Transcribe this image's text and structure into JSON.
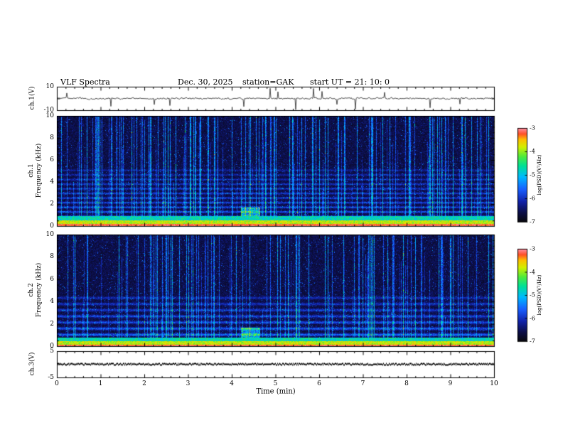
{
  "header": {
    "title": "VLF  Spectra",
    "date": "Dec. 30,  2025",
    "station": "station=GAK",
    "start_ut": "start UT  =   21: 10: 0"
  },
  "axes": {
    "x": {
      "label": "Time  (min)",
      "min": 0,
      "max": 10,
      "ticks": [
        0,
        1,
        2,
        3,
        4,
        5,
        6,
        7,
        8,
        9,
        10
      ]
    },
    "panels": [
      {
        "id": "ch1_wave",
        "ylabel": "ch.1(V)",
        "ymin": -10,
        "ymax": 10,
        "yticks": [
          10,
          -10
        ]
      },
      {
        "id": "ch1_spec",
        "ylabel_line1": "ch.1",
        "ylabel_line2": "Frequency (kHz)",
        "ymin": 0,
        "ymax": 10,
        "yticks": [
          0,
          2,
          4,
          6,
          8,
          10
        ]
      },
      {
        "id": "ch2_spec",
        "ylabel_line1": "ch.2",
        "ylabel_line2": "Frequency (kHz)",
        "ymin": 0,
        "ymax": 10,
        "yticks": [
          0,
          2,
          4,
          6,
          8,
          10
        ]
      },
      {
        "id": "ch3_wave",
        "ylabel": "ch.3(V)",
        "ymin": -5,
        "ymax": 5,
        "yticks": [
          5,
          -5
        ]
      }
    ]
  },
  "colorbars": [
    {
      "label": "log(PSD)(V²/Hz)",
      "min": -7,
      "max": -3,
      "ticks": [
        -3,
        -4,
        -5,
        -6,
        -7
      ]
    },
    {
      "label": "log(PSD)(V²/Hz)",
      "min": -7,
      "max": -3,
      "ticks": [
        -3,
        -4,
        -5,
        -6,
        -7
      ]
    }
  ],
  "colors": {
    "background": "#ffffff",
    "axis": "#000000",
    "colormap_low": "#000008",
    "colormap_mid": "#00b9ff",
    "colormap_high": "#ff91a5"
  },
  "chart_data": [
    {
      "type": "line",
      "panel": "ch1_waveform",
      "ylabel": "ch.1(V)",
      "xlim": [
        0,
        10
      ],
      "ylim": [
        -10,
        10
      ],
      "x_unit": "min",
      "description": "Continuous noisy VLF waveform centred near 0 V, typical excursions about ±2 V, with roughly 15 impulsive spikes reaching up to ±10 V across the 10-minute record"
    },
    {
      "type": "heatmap",
      "panel": "ch1_spectrogram",
      "ylabel": "ch.1 Frequency (kHz)",
      "xlabel": "Time (min)",
      "xlim": [
        0,
        10
      ],
      "ylim": [
        0,
        10
      ],
      "zlabel": "log(PSD)(V²/Hz)",
      "zlim": [
        -7,
        -3
      ],
      "features": [
        "intense red band below ~0.3 kHz (PSD near -3)",
        "yellow/green band from ~0.3 to 1 kHz (PSD near -4)",
        "horizontal banding between 1 and ~5 kHz (PSD near -5.5)",
        "dense vertical sferic streaks, many reaching 10 kHz, green/cyan (PSD near -4.5)",
        "dark background near -7 above 5 kHz",
        "small green enhancement near 1-1.7 kHz around t = 4.3-4.6 min"
      ]
    },
    {
      "type": "heatmap",
      "panel": "ch2_spectrogram",
      "ylabel": "ch.2 Frequency (kHz)",
      "xlabel": "Time (min)",
      "xlim": [
        0,
        10
      ],
      "ylim": [
        0,
        10
      ],
      "zlabel": "log(PSD)(V²/Hz)",
      "zlim": [
        -7,
        -3
      ],
      "features": [
        "thin red/yellow band below ~0.5 kHz",
        "strong horizontal banding between 1 and ~4.6 kHz",
        "fewer vertical sferic streaks than ch.1, mostly blue/cyan",
        "dark background near -7 above 5 kHz",
        "small green enhancement near 1-1.7 kHz around t = 4.3-4.6 min"
      ]
    },
    {
      "type": "line",
      "panel": "ch3_waveform",
      "ylabel": "ch.3(V)",
      "xlim": [
        0,
        10
      ],
      "ylim": [
        -5,
        5
      ],
      "description": "Essentially flat dense trace at ~0 V for the entire 10 minutes"
    }
  ]
}
